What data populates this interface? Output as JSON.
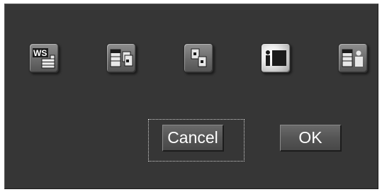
{
  "icons": [
    {
      "name": "ws-server-icon",
      "glyph": "WS",
      "selected": false
    },
    {
      "name": "server-documents-icon",
      "glyph": "",
      "selected": false
    },
    {
      "name": "documents-icon",
      "glyph": "",
      "selected": false
    },
    {
      "name": "user-panel-icon",
      "glyph": "",
      "selected": true
    },
    {
      "name": "server-user-icon",
      "glyph": "",
      "selected": false
    }
  ],
  "buttons": {
    "cancel_label": "Cancel",
    "ok_label": "OK"
  },
  "colors": {
    "dialog_bg": "#363636",
    "button_text": "#ffffff"
  }
}
